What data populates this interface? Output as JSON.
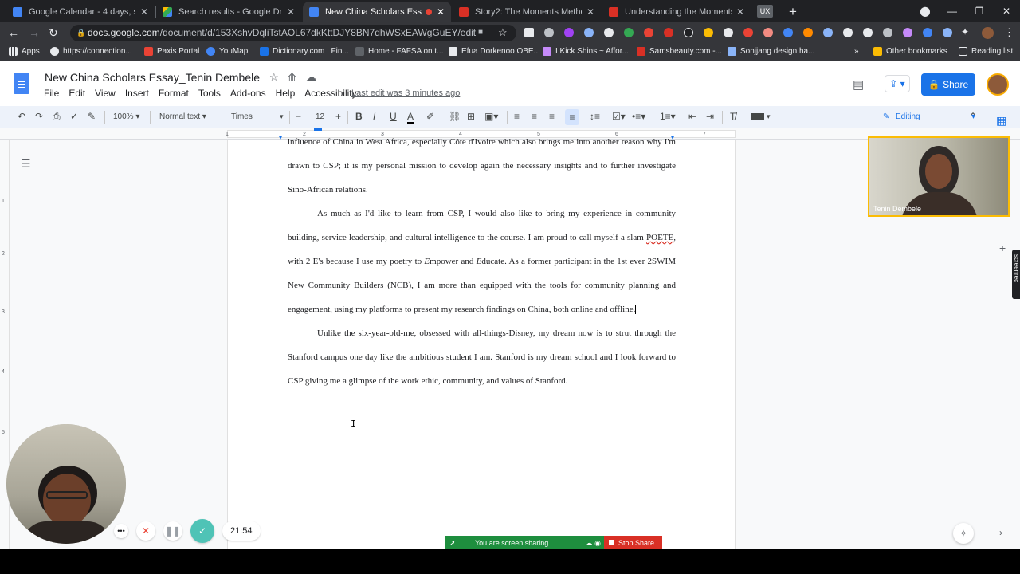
{
  "tabs": [
    {
      "title": "Google Calendar - 4 days, startin",
      "fav_color": "#4285f4"
    },
    {
      "title": "Search results - Google Drive",
      "fav_color": "#fbbc04"
    },
    {
      "title": "New China Scholars Essay_Te",
      "fav_color": "#4285f4",
      "active": true
    },
    {
      "title": "Story2: The Moments Method",
      "fav_color": "#d93025"
    },
    {
      "title": "Understanding the Moments Me",
      "fav_color": "#d93025"
    }
  ],
  "tab_ux": "UX",
  "address": {
    "domain": "docs.google.com",
    "path": "/document/d/153XshvDqliTstAOL67dkKttDJY8BN7dhWSxEAWgGuEY/edit"
  },
  "bookmarks": [
    "Apps",
    "https://connection...",
    "Paxis Portal",
    "YouMap",
    "Dictionary.com | Fin...",
    "Home - FAFSA on t...",
    "Efua Dorkenoo OBE...",
    "I Kick Shins ~ Affor...",
    "Samsbeauty.com -...",
    "Sonjjang design ha..."
  ],
  "bookmarks_right": [
    "Other bookmarks",
    "Reading list"
  ],
  "bookmarks_more": "»",
  "doc": {
    "title": "New China Scholars Essay_Tenin Dembele",
    "menu": [
      "File",
      "Edit",
      "View",
      "Insert",
      "Format",
      "Tools",
      "Add-ons",
      "Help",
      "Accessibility"
    ],
    "last_edit": "Last edit was 3 minutes ago",
    "share_label": "Share"
  },
  "toolbar": {
    "zoom": "100%",
    "style": "Normal text",
    "font": "Times",
    "size": "12",
    "mode": "Editing"
  },
  "ruler": [
    "1",
    "2",
    "3",
    "4",
    "5",
    "6",
    "7"
  ],
  "vruler": [
    "1",
    "2",
    "3",
    "4",
    "5"
  ],
  "body": {
    "p0": "influence of China in West Africa, especially Côte d'Ivoire which also brings me into another reason why I'm drawn to CSP; it is my personal mission to develop again the necessary insights and to further investigate Sino-African relations.",
    "p1_a": "As much as I'd like to learn from CSP, I would also like to bring my experience in community building, service leadership, and cultural intelligence to the course. I am proud to call myself a slam ",
    "p1_poete": "POETE",
    "p1_b": ", with 2 E's because I use my poetry to ",
    "p1_e1": "E",
    "p1_c": "mpower and ",
    "p1_e2": "E",
    "p1_d": "ducate. As a former participant in the 1st ever 2SWIM New Community Builders (NCB), I am more than equipped with the tools for community planning and engagement, using my platforms to present my research findings on China, both online and offline.",
    "p2": "Unlike the six-year-old-me, obsessed with all-things-Disney, my dream now is to strut through the Stanford campus one day like the ambitious student I am. Stanford is my dream school and I look forward to CSP giving me a glimpse of the work ethic, community, and values of Stanford."
  },
  "participants": {
    "right_name": "Tenin Dembele"
  },
  "recorder": {
    "timer": "21:54"
  },
  "screen_share": {
    "message": "You are screen sharing",
    "stop": "Stop Share"
  },
  "side_label": "screenrec"
}
